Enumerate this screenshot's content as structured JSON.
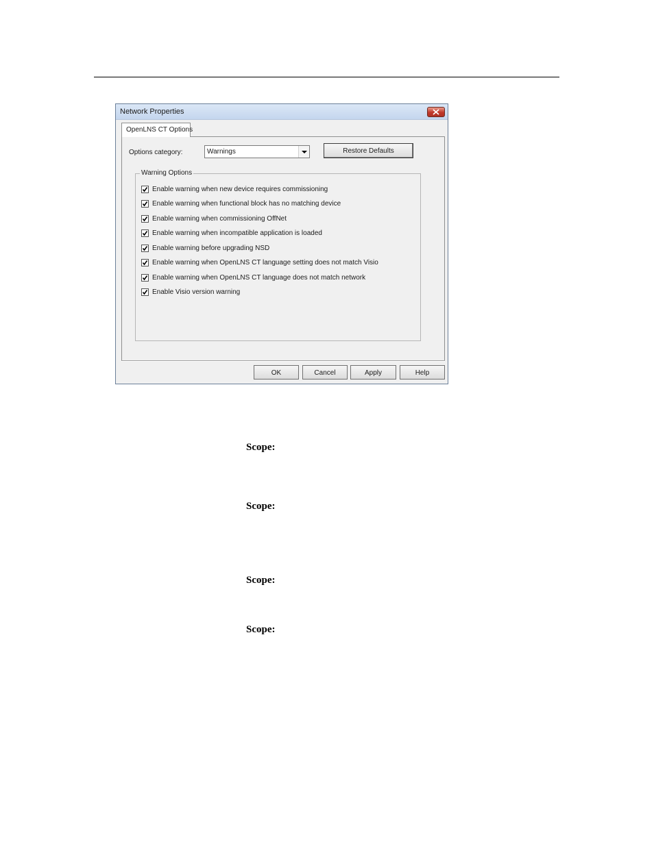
{
  "dialog": {
    "title": "Network Properties",
    "tab_label": "OpenLNS CT Options",
    "options_category_label": "Options category:",
    "options_category_value": "Warnings",
    "restore_defaults_label": "Restore Defaults",
    "group_title": "Warning Options",
    "options": [
      {
        "label": "Enable warning when new device requires commissioning",
        "checked": true
      },
      {
        "label": "Enable warning when functional block has no matching device",
        "checked": true
      },
      {
        "label": "Enable warning when commissioning OffNet",
        "checked": true
      },
      {
        "label": "Enable warning when incompatible application is loaded",
        "checked": true
      },
      {
        "label": "Enable warning before upgrading NSD",
        "checked": true
      },
      {
        "label": "Enable warning when OpenLNS CT language setting does not match Visio",
        "checked": true
      },
      {
        "label": "Enable warning when OpenLNS CT language does not match network",
        "checked": true
      },
      {
        "label": "Enable Visio version warning",
        "checked": true
      }
    ],
    "buttons": {
      "ok": "OK",
      "cancel": "Cancel",
      "apply": "Apply",
      "help": "Help"
    }
  },
  "document": {
    "scope_labels": [
      "Scope:",
      "Scope:",
      "Scope:",
      "Scope:"
    ]
  },
  "colors": {
    "titlebar": "#c4d6ee",
    "close_button": "#c0392b",
    "dialog_background": "#f0f0f0"
  },
  "icons": {
    "close": "close-icon",
    "dropdown": "chevron-down-icon",
    "check": "check-icon"
  }
}
